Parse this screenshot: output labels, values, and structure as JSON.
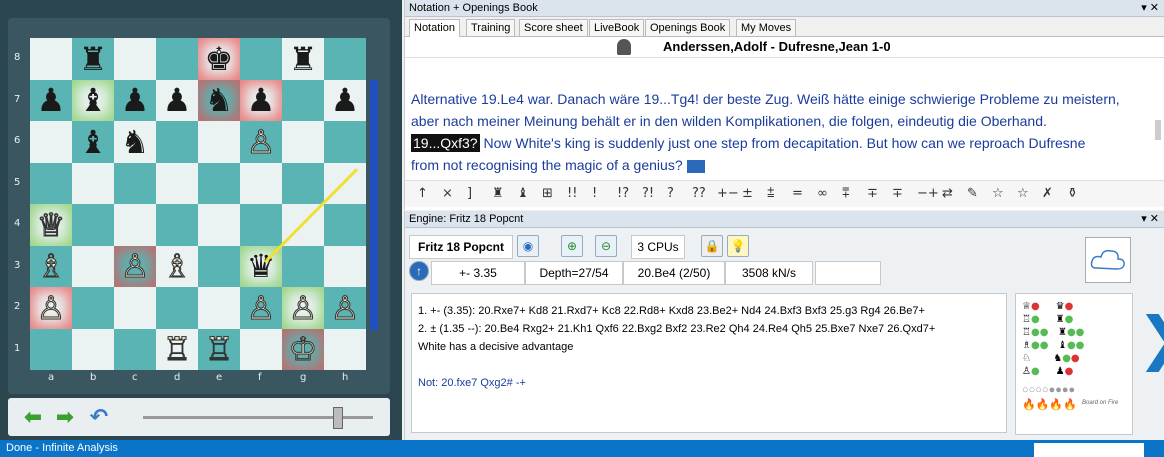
{
  "board": {
    "ranks": [
      "8",
      "7",
      "6",
      "5",
      "4",
      "3",
      "2",
      "1"
    ],
    "files": [
      "a",
      "b",
      "c",
      "d",
      "e",
      "f",
      "g",
      "h"
    ],
    "pieces": [
      {
        "sq": "b8",
        "glyph": "♜",
        "side": "b"
      },
      {
        "sq": "e8",
        "glyph": "♚",
        "side": "b",
        "glow": "r"
      },
      {
        "sq": "g8",
        "glyph": "♜",
        "side": "b"
      },
      {
        "sq": "a7",
        "glyph": "♟",
        "side": "b"
      },
      {
        "sq": "b7",
        "glyph": "♝",
        "side": "b",
        "glow": "g"
      },
      {
        "sq": "c7",
        "glyph": "♟",
        "side": "b"
      },
      {
        "sq": "d7",
        "glyph": "♟",
        "side": "b"
      },
      {
        "sq": "e7",
        "glyph": "♞",
        "side": "b",
        "glow": "r"
      },
      {
        "sq": "f7",
        "glyph": "♟",
        "side": "b",
        "glow": "r"
      },
      {
        "sq": "h7",
        "glyph": "♟",
        "side": "b"
      },
      {
        "sq": "b6",
        "glyph": "♝",
        "side": "b"
      },
      {
        "sq": "c6",
        "glyph": "♞",
        "side": "b"
      },
      {
        "sq": "f6",
        "glyph": "♙",
        "side": "w"
      },
      {
        "sq": "a4",
        "glyph": "♕",
        "side": "w",
        "glow": "g"
      },
      {
        "sq": "a3",
        "glyph": "♗",
        "side": "w"
      },
      {
        "sq": "c3",
        "glyph": "♙",
        "side": "w",
        "glow": "r"
      },
      {
        "sq": "d3",
        "glyph": "♗",
        "side": "w"
      },
      {
        "sq": "f3",
        "glyph": "♛",
        "side": "b",
        "glow": "g"
      },
      {
        "sq": "a2",
        "glyph": "♙",
        "side": "w",
        "glow": "r"
      },
      {
        "sq": "f2",
        "glyph": "♙",
        "side": "w"
      },
      {
        "sq": "g2",
        "glyph": "♙",
        "side": "w",
        "glow": "g"
      },
      {
        "sq": "h2",
        "glyph": "♙",
        "side": "w"
      },
      {
        "sq": "d1",
        "glyph": "♖",
        "side": "w"
      },
      {
        "sq": "e1",
        "glyph": "♖",
        "side": "w"
      },
      {
        "sq": "g1",
        "glyph": "♔",
        "side": "w",
        "glow": "r"
      }
    ],
    "arrow": {
      "from": "h5",
      "to": "f3",
      "color": "#f0e030"
    }
  },
  "notation_panel": {
    "title": "Notation + Openings Book",
    "tabs": [
      "Notation",
      "Training",
      "Score sheet",
      "LiveBook",
      "Openings Book",
      "My Moves"
    ],
    "game_header": "Anderssen,Adolf - Dufresne,Jean  1-0",
    "lines": [
      "Alternative 19.Le4 war. Danach wäre 19...Tg4! der beste Zug. Weiß hätte einige schwierige Probleme zu meistern,",
      "aber nach meiner Meinung behält er in den wilden Komplikationen, die folgen, eindeutig die Oberhand."
    ],
    "move_highlight": "19...Qxf3?",
    "move_comment": " Now White's king is suddenly just one step from decapitation. But how can we reproach Dufresne",
    "last_line": "from not recognising the magic of a genius?",
    "symbols": [
      "↑",
      "⨯",
      "]",
      "♜",
      "♝",
      "⊞",
      "!!",
      "!",
      "!?",
      "?!",
      "?",
      "??",
      "+−",
      "±",
      "⩲",
      "=",
      "∞",
      "⩱",
      "∓",
      "∓",
      "−+",
      "⇄",
      "✎",
      "☆",
      "☆",
      "✗",
      "⚱"
    ]
  },
  "engine_panel": {
    "title": "Engine: Fritz 18 Popcnt",
    "engine_name": "Fritz 18 Popcnt",
    "cpus": "3 CPUs",
    "eval": "+- 3.35",
    "depth": "Depth=27/54",
    "current_move": "20.Be4 (2/50)",
    "speed": "3508 kN/s",
    "lines": [
      "1. +- (3.35): 20.Rxe7+ Kd8 21.Rxd7+ Kc8 22.Rd8+ Kxd8 23.Be2+ Nd4 24.Bxf3 Bxf3 25.g3 Rg4 26.Be7+",
      "2. ± (1.35 --): 20.Be4 Rxg2+ 21.Kh1 Qxf6 22.Bxg2 Bxf2 23.Re2 Qh4 24.Re4 Qh5 25.Bxe7 Nxe7 26.Qxd7+",
      "White has a decisive advantage",
      "",
      "Not: 20.fxe7 Qxg2#  -+"
    ],
    "board_on_fire": "Board on Fire"
  },
  "status": {
    "text": "Done - Infinite Analysis"
  },
  "colors": {
    "accent": "#0a74c8",
    "board_dark": "#5ab4b4",
    "board_light": "#eaf2f2",
    "notation_text": "#1a3c9c"
  }
}
